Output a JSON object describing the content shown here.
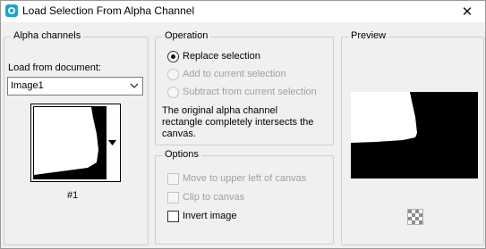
{
  "window": {
    "title": "Load Selection From Alpha Channel",
    "close_glyph": "✕"
  },
  "alpha_channels": {
    "group_label": "Alpha channels",
    "load_from_label": "Load from document:",
    "document_value": "Image1",
    "channel_label": "#1"
  },
  "operation": {
    "group_label": "Operation",
    "options": [
      {
        "label": "Replace selection",
        "selected": true,
        "enabled": true
      },
      {
        "label": "Add to current selection",
        "selected": false,
        "enabled": false
      },
      {
        "label": "Subtract from current selection",
        "selected": false,
        "enabled": false
      }
    ],
    "message_line1": "The original alpha channel",
    "message_line2": "rectangle completely intersects the",
    "message_line3": "canvas."
  },
  "options": {
    "group_label": "Options",
    "items": [
      {
        "label": "Move to upper left of canvas",
        "checked": false,
        "enabled": false
      },
      {
        "label": "Clip to canvas",
        "checked": false,
        "enabled": false
      },
      {
        "label": "Invert image",
        "checked": false,
        "enabled": true
      }
    ]
  },
  "preview": {
    "group_label": "Preview"
  },
  "icons": {
    "app": "paint-shop-icon",
    "dropdown": "chevron-down-icon",
    "thumb_menu": "triangle-down-icon",
    "checker": "checkerboard-icon"
  },
  "colors": {
    "mask_white": "#ffffff",
    "mask_black": "#000000"
  }
}
